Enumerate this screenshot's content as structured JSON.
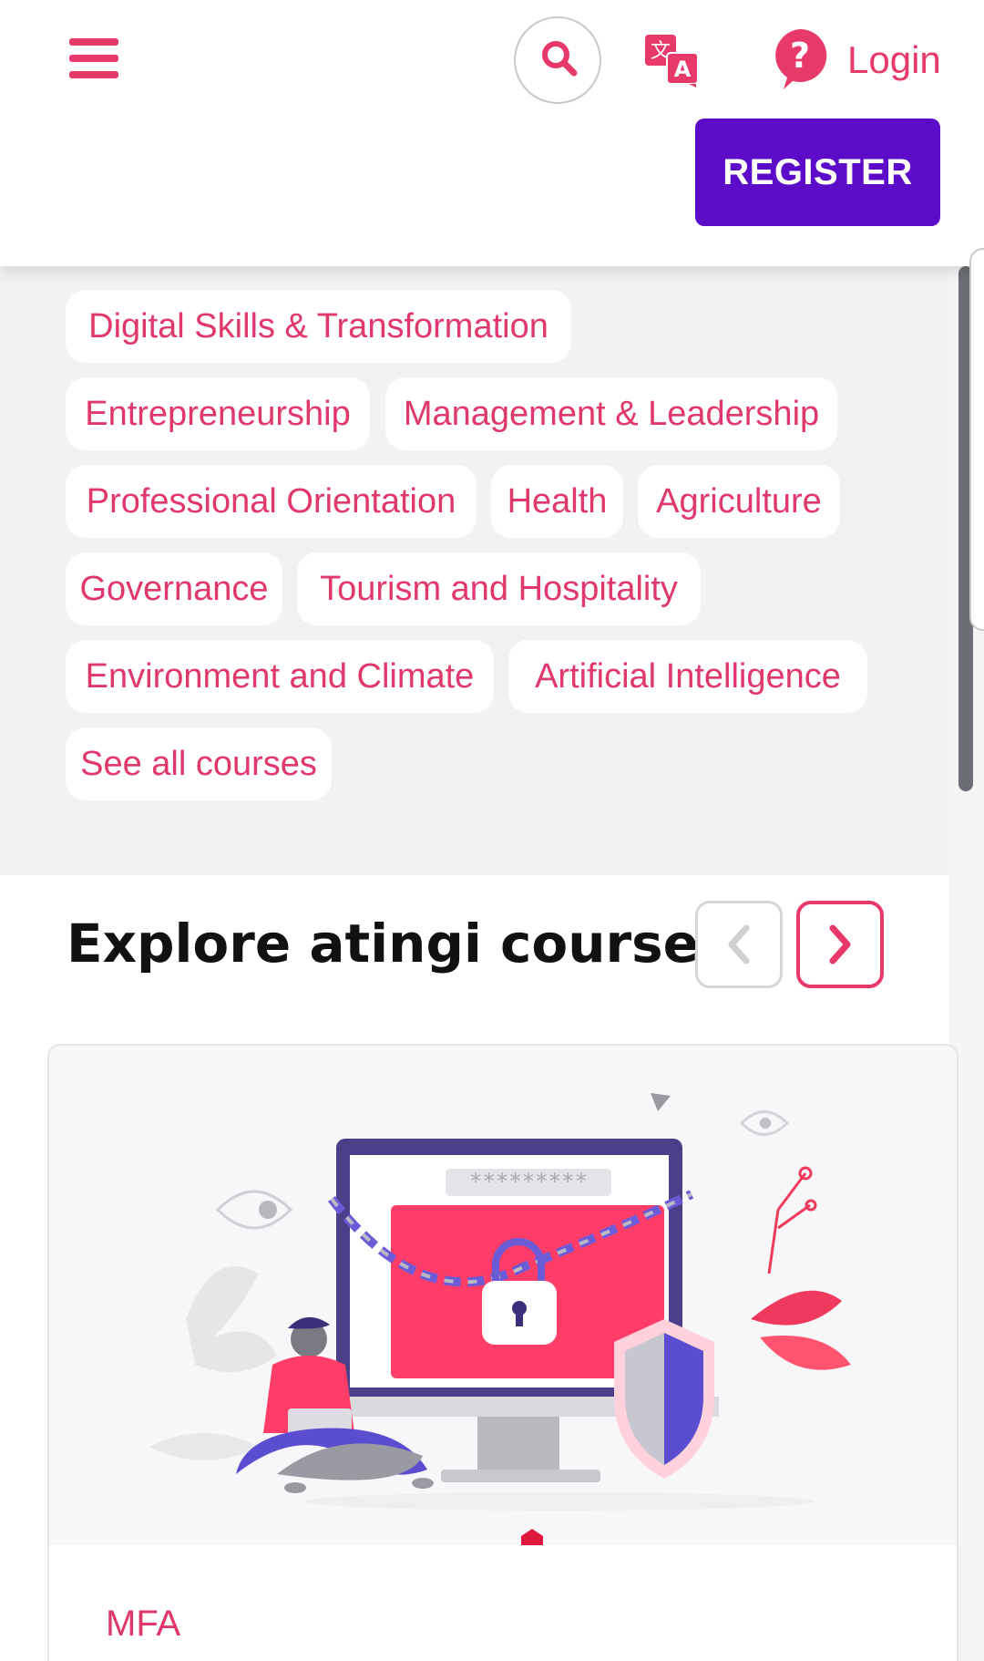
{
  "header": {
    "login_label": "Login",
    "register_label": "REGISTER"
  },
  "categories": [
    "Digital Skills & Transformation",
    "Entrepreneurship",
    "Management & Leadership",
    "Professional Orientation",
    "Health",
    "Agriculture",
    "Governance",
    "Tourism and Hospitality",
    "Environment and Climate",
    "Artificial Intelligence",
    "See all courses"
  ],
  "explore": {
    "title": "Explore atingi courses"
  },
  "course_card": {
    "password_text": "*********",
    "tag": "MFA"
  },
  "colors": {
    "accent": "#e8396b",
    "register": "#5c0bc9",
    "section_bg": "#f2f2f3"
  },
  "icons": [
    "hamburger-menu-icon",
    "search-icon",
    "translate-icon",
    "help-icon",
    "chevron-left-icon",
    "chevron-right-icon"
  ]
}
